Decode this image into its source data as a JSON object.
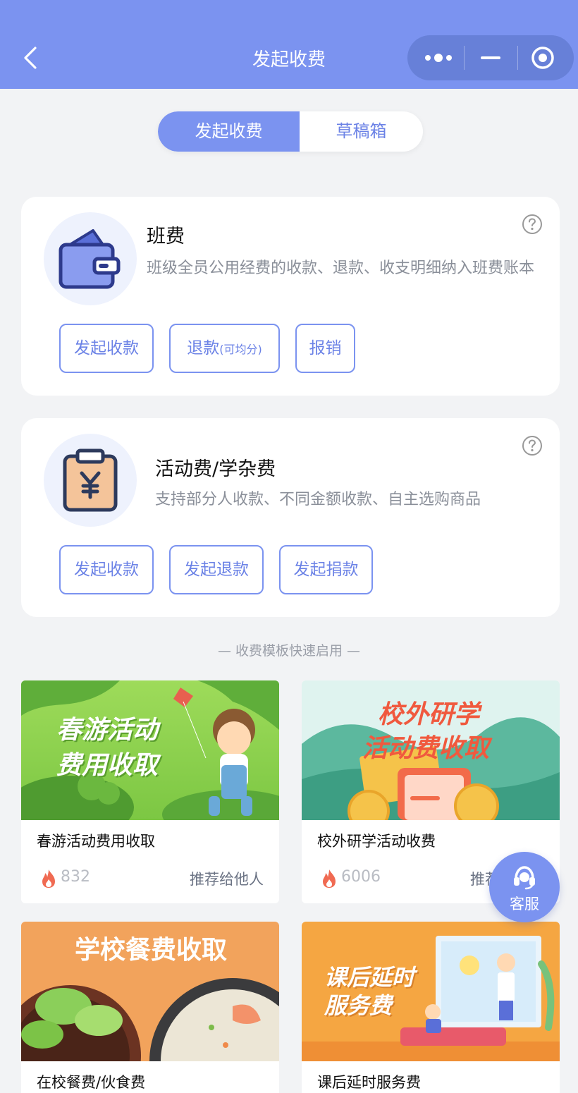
{
  "navbar": {
    "title": "发起收费"
  },
  "tabs": {
    "active": "发起收费",
    "inactive": "草稿箱"
  },
  "class_fee": {
    "title": "班费",
    "description": "班级全员公用经费的收款、退款、收支明细纳入班费账本",
    "buttons": {
      "collect": "发起收款",
      "refund": "退款",
      "refund_note": "(可均分)",
      "reimburse": "报销"
    }
  },
  "activity_fee": {
    "title": "活动费/学杂费",
    "description": "支持部分人收款、不同金额收款、自主选购商品",
    "buttons": {
      "collect": "发起收款",
      "refund": "发起退款",
      "donate": "发起捐款"
    }
  },
  "templates": {
    "section_label": "— 收费模板快速启用 —",
    "share_label": "推荐给他人",
    "items": [
      {
        "banner_text": [
          "春游活动",
          "费用收取"
        ],
        "name": "春游活动费用收取",
        "count": "832"
      },
      {
        "banner_text": [
          "校外研学",
          "活动费收取"
        ],
        "name": "校外研学活动收费",
        "count": "6006"
      },
      {
        "banner_text": [
          "学校餐费收取"
        ],
        "name": "在校餐费/伙食费"
      },
      {
        "banner_text": [
          "课后延时",
          "服务费"
        ],
        "name": "课后延时服务费"
      }
    ]
  },
  "customer_service": {
    "label": "客服"
  },
  "colors": {
    "primary": "#7b93f0",
    "primary_text": "#6b82e6",
    "background": "#f2f3f5",
    "fire": "#f06a52"
  },
  "icons": [
    "back-chevron-icon",
    "more-dots-icon",
    "minimize-icon",
    "close-target-icon",
    "wallet-icon",
    "yuan-clipboard-icon",
    "help-icon",
    "fire-icon",
    "headset-icon"
  ]
}
